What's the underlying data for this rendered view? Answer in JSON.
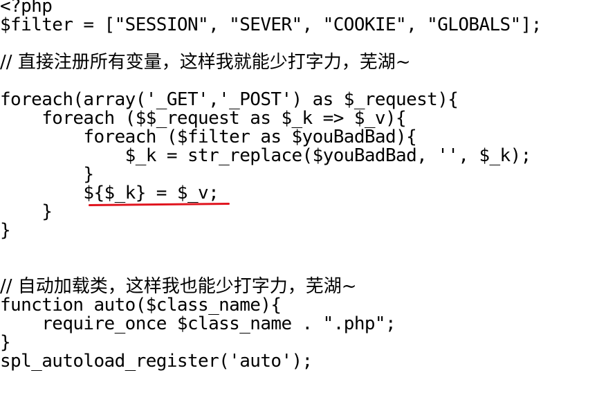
{
  "editor": {
    "lines": [
      "<?php",
      "$filter = [\"SESSION\", \"SEVER\", \"COOKIE\", \"GLOBALS\"];",
      "",
      "// 直接注册所有变量，这样我就能少打字力，芜湖~",
      "",
      "foreach(array('_GET','_POST') as $_request){",
      "    foreach ($$_request as $_k => $_v){",
      "        foreach ($filter as $youBadBad){",
      "            $_k = str_replace($youBadBad, '', $_k);",
      "        }",
      "        ${$_k} = $_v;",
      "    }",
      "}",
      "",
      "",
      "// 自动加载类，这样我也能少打字力，芜湖~",
      "function auto($class_name){",
      "    require_once $class_name . \".php\";",
      "}",
      "spl_autoload_register('auto');"
    ]
  },
  "annotation": {
    "underline_color": "#e0141e"
  }
}
